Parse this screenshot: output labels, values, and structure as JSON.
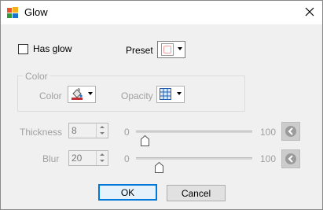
{
  "window": {
    "title": "Glow"
  },
  "has_glow": {
    "label": "Has glow",
    "checked": false
  },
  "preset": {
    "label": "Preset",
    "swatch_color": "#f4a0a0"
  },
  "color_group": {
    "title": "Color",
    "color_label": "Color",
    "opacity_label": "Opacity"
  },
  "thickness": {
    "label": "Thickness",
    "value": "8",
    "min": "0",
    "max": "100",
    "slider_fraction": 0.08
  },
  "blur": {
    "label": "Blur",
    "value": "20",
    "min": "0",
    "max": "100",
    "slider_fraction": 0.2
  },
  "buttons": {
    "ok": "OK",
    "cancel": "Cancel"
  },
  "colors": {
    "accent": "#0078d7",
    "disabled_text": "#a0a0a0"
  }
}
